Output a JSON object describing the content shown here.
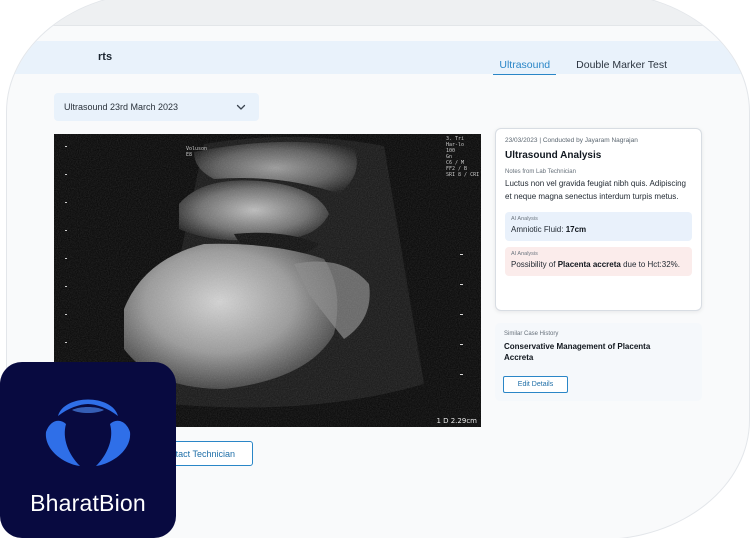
{
  "header": {
    "page_title_fragment": "rts",
    "tabs": [
      {
        "label": "Ultrasound",
        "active": true
      },
      {
        "label": "Double Marker Test",
        "active": false
      }
    ]
  },
  "report_select": {
    "value": "Ultrasound 23rd March 2023"
  },
  "scan": {
    "top_right_lines": [
      "3. Tri",
      "Har-lo",
      "100",
      "Gn",
      "C6 / M",
      "FF2 / B",
      "SRI 8 / CRI"
    ],
    "top_left_lines": [
      "Voluson",
      "E8"
    ],
    "depth_readout": "1 D 2.29cm"
  },
  "contact_button": {
    "label": "tact Technician"
  },
  "analysis": {
    "meta": "23/03/2023 | Conducted by Jayaram Nagrajan",
    "title": "Ultrasound Analysis",
    "notes_label": "Notes from Lab Technician",
    "notes": "Luctus non vel gravida feugiat nibh quis. Adipiscing et neque magna senectus interdum turpis metus.",
    "ai_1": {
      "label": "AI Analysis",
      "prefix": "Amniotic Fluid: ",
      "value": "17cm"
    },
    "ai_2": {
      "label": "AI Analysis",
      "prefix": "Possibility of ",
      "value": "Placenta accreta",
      "suffix": " due to Hct:32%."
    }
  },
  "similar_case": {
    "label": "Similar Case History",
    "title": "Conservative Management of Placenta Accreta",
    "button": "Edit Details"
  },
  "brand": {
    "name": "BharatBion",
    "tile_color": "#080a40",
    "mark_color": "#2f6fe8"
  },
  "colors": {
    "accent": "#2a86c7",
    "header_bg": "#e9f2fb",
    "alert_bg": "#fbeceb"
  }
}
